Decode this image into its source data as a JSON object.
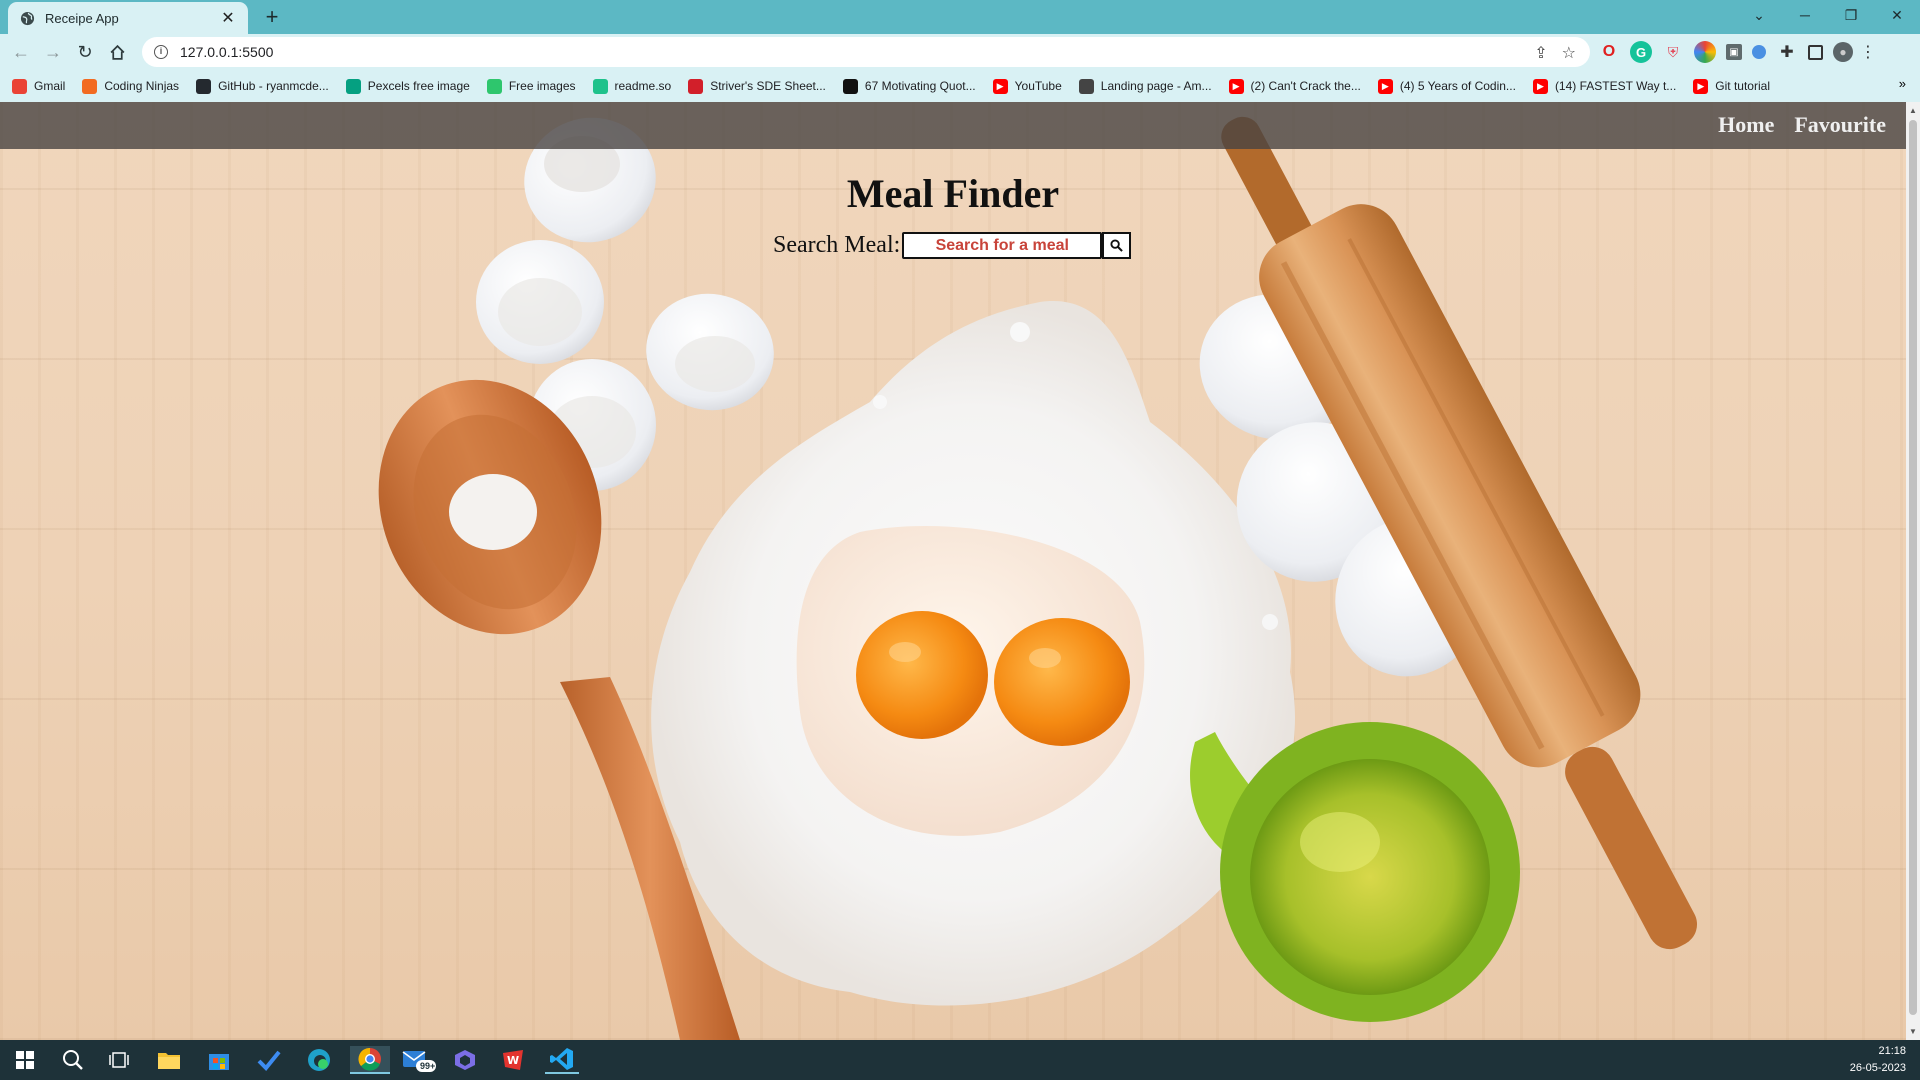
{
  "browser": {
    "tab_title": "Receipe App",
    "url": "127.0.0.1:5500",
    "bookmarks": [
      {
        "label": "Gmail",
        "icon": "gmail-icon",
        "color": "#ea4335"
      },
      {
        "label": "Coding Ninjas",
        "icon": "coding-ninjas-icon",
        "color": "#f26b21"
      },
      {
        "label": "GitHub - ryanmcde...",
        "icon": "github-icon",
        "color": "#24292f"
      },
      {
        "label": "Pexcels free image",
        "icon": "pexels-icon",
        "color": "#05a081"
      },
      {
        "label": "Free images",
        "icon": "pixabay-icon",
        "color": "#2ec66d"
      },
      {
        "label": "readme.so",
        "icon": "readme-icon",
        "color": "#1ec28b"
      },
      {
        "label": "Striver's SDE Sheet...",
        "icon": "takeuforward-icon",
        "color": "#d21f2a"
      },
      {
        "label": "67 Motivating Quot...",
        "icon": "hourglass-icon",
        "color": "#111111"
      },
      {
        "label": "YouTube",
        "icon": "youtube-icon",
        "color": "#ff0000"
      },
      {
        "label": "Landing page - Am...",
        "icon": "landing-icon",
        "color": "#444444"
      },
      {
        "label": "(2) Can't Crack the...",
        "icon": "youtube-icon",
        "color": "#ff0000"
      },
      {
        "label": "(4) 5 Years of Codin...",
        "icon": "youtube-icon",
        "color": "#ff0000"
      },
      {
        "label": "(14) FASTEST Way t...",
        "icon": "youtube-icon",
        "color": "#ff0000"
      },
      {
        "label": "Git tutorial",
        "icon": "youtube-icon",
        "color": "#ff0000"
      }
    ]
  },
  "page": {
    "nav_links": [
      "Home",
      "Favourite"
    ],
    "title": "Meal Finder",
    "search_label": "Search Meal:",
    "search_placeholder": "Search for a meal",
    "search_button_icon": "magnifier-icon",
    "background": "flour, eggs, wooden spoon and rolling pin on a wooden table"
  },
  "taskbar": {
    "badge": "99+",
    "time": "21:18",
    "date": "26-05-2023"
  },
  "colors": {
    "tab_strip": "#5cb8c4",
    "toolbar": "#d9f1f4",
    "navbar": "#484442",
    "placeholder": "#c8443a",
    "taskbar": "#1e3239"
  }
}
